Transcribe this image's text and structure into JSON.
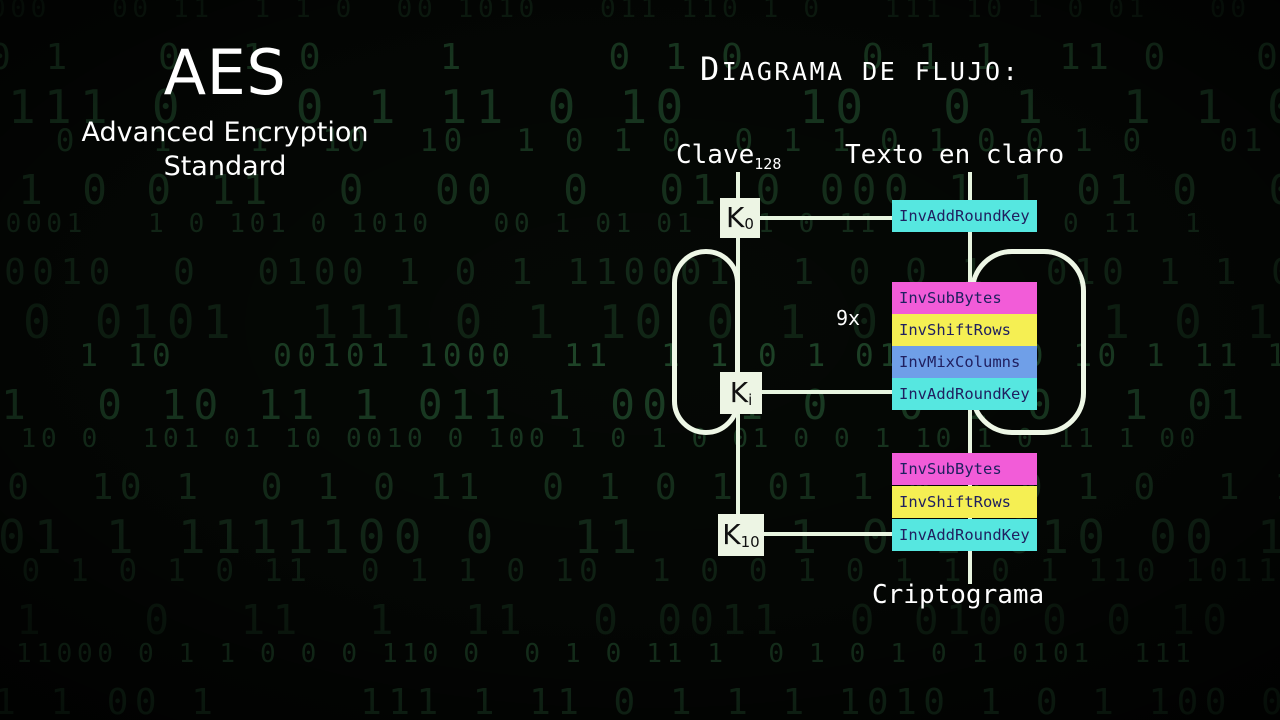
{
  "background": {
    "style": "binary-digit-rain",
    "color_digits": "#2f6b3f",
    "color_base": "#050805",
    "rows": [
      "000   00 11  1 1 0  00 1010   011 110 1 0   111 10 1 0 01   00",
      " 0 1   0  1 0    1     0 1 0    0 1 1  11 0   0 1 0 1 1  0 1  0",
      "0111 0   0 1 11 0 10   10  0 1  1 1 010  1111 010 1101 11  10",
      "1  0   1   1  10  10  1 0 1 0  0 1 1 0 1 0 0 1 0   01 01 11 1",
      "  1 0 0 11  0  00  0  01 0 000 1 1 01 0  0 1 0 1  1 01 11   0",
      "010001   1 0 101 0 1010   00 1 01 01 1 1 0 11 1 1000  0 11  1",
      " 0010  0  0100 1 0 1 110001  1 0 0 1  010 1 1 0 0 1 030011  10",
      " 0 0101  111 0 1 10 0 1 0 000  1 0 11  0 10 0 1 1 0 01 0 11 0",
      " 1   1 10    00101 1000  11  1 1 0 1 01 0 1 0 10 1 11 1  1 0",
      " 1  0 10 11 1 011 1 00  1 0  0 1 0  1 01 0 1 1 0 1 0 11 0 1 0",
      "0 10 0  101 01 10 0010 0 100 1 0 1 0 01 0 0 1 10 1 0 11 1 00",
      "000  10 1  0 1 0 11  0 1 0 1 01 1 0 1 0 1 0  1 1  1  100 01 1",
      " 01 1 1111100 0  11  0 1 0 1 010 00 1 0 1 0 1 10 0 11011 011",
      "  0 1 0 1 0 11  0 1 1 0 10  1 0 0 1 0 1 1 0 1 110 10110 10001 0",
      " 1   0  11  1  11  0 0011  0 010 0 0 10  0 1 0 11 0 0 1  1190",
      " 1 11000 0 1 1 0 0 0 110 0  0 1 0 11 1  0 1 0 1 0 1 0101  111",
      "01 1 00 1     111 1 11 0 1 1 1 1010 1 0 1 100 0 1 10 1 0 1 0"
    ]
  },
  "title_block": {
    "acronym": "AES",
    "expansion_line1": "Advanced Encryption",
    "expansion_line2": "Standard"
  },
  "heading": {
    "first_letter": "D",
    "rest": "IAGRAMA DE FLUJO:"
  },
  "diagram": {
    "labels": {
      "key_input": "Clave",
      "key_input_sub": "128",
      "plaintext": "Texto en claro",
      "ciphertext": "Criptograma",
      "repeat": "9x"
    },
    "key_boxes": [
      {
        "name": "k0",
        "letter": "K",
        "sub": "0"
      },
      {
        "name": "ki",
        "letter": "K",
        "sub": "i"
      },
      {
        "name": "k10",
        "letter": "K",
        "sub": "10"
      }
    ],
    "round_initial": [
      {
        "op": "InvAddRoundKey",
        "color": "#56e7e0"
      }
    ],
    "round_main": [
      {
        "op": "InvSubBytes",
        "color": "#f25cd8"
      },
      {
        "op": "InvShiftRows",
        "color": "#f5ef53"
      },
      {
        "op": "InvMixColumns",
        "color": "#6f9fe8"
      },
      {
        "op": "InvAddRoundKey",
        "color": "#56e7e0"
      }
    ],
    "round_final": [
      {
        "op": "InvSubBytes",
        "color": "#f25cd8"
      },
      {
        "op": "InvShiftRows",
        "color": "#f5ef53"
      },
      {
        "op": "InvAddRoundKey",
        "color": "#56e7e0"
      }
    ],
    "colors": {
      "wire": "#e8f5e0",
      "key_box_fill": "#edf5e4",
      "op_text": "#202060",
      "text": "#ffffff"
    }
  }
}
